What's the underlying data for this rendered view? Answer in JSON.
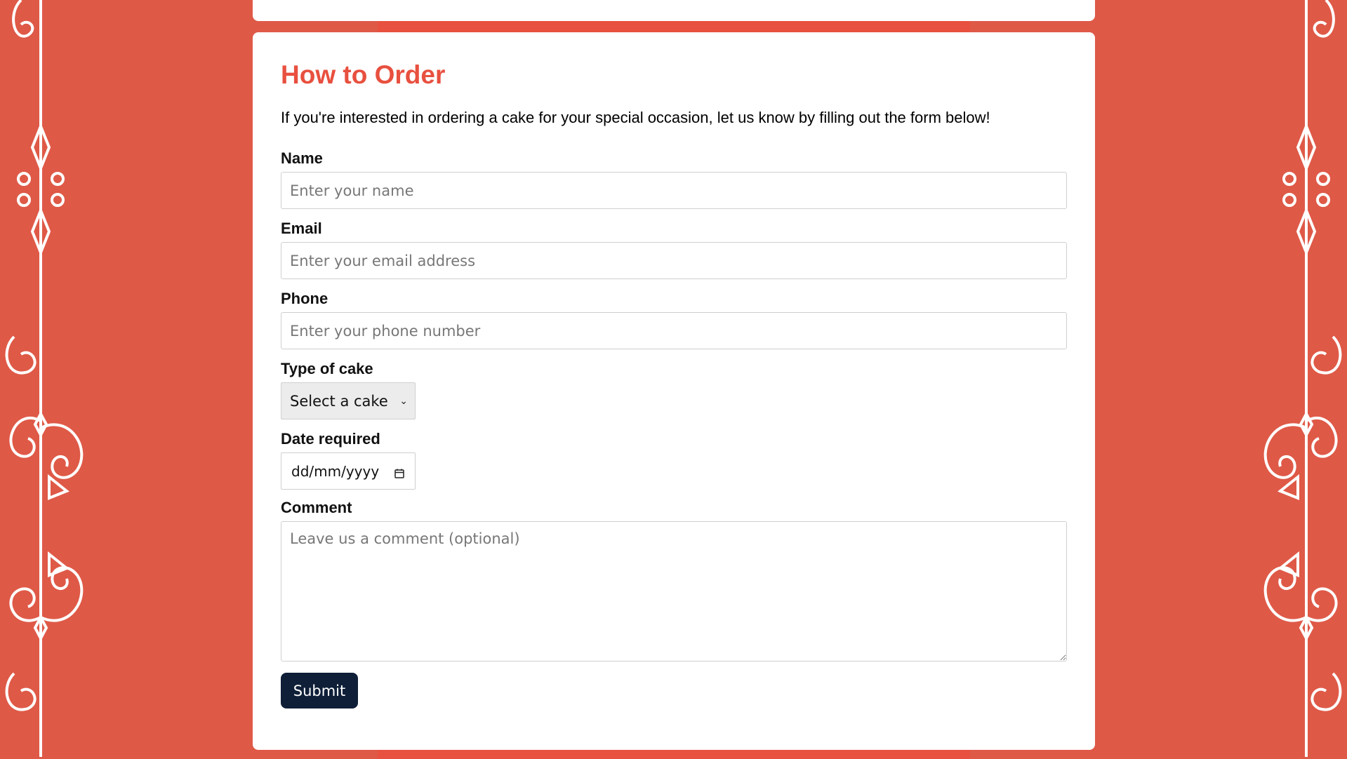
{
  "section": {
    "title": "How to Order",
    "intro": "If you're interested in ordering a cake for your special occasion, let us know by filling out the form below!"
  },
  "form": {
    "name_label": "Name",
    "name_placeholder": "Enter your name",
    "email_label": "Email",
    "email_placeholder": "Enter your email address",
    "phone_label": "Phone",
    "phone_placeholder": "Enter your phone number",
    "cake_label": "Type of cake",
    "cake_selected": "Select a cake",
    "date_label": "Date required",
    "date_placeholder": "dd/mm/yyyy",
    "comment_label": "Comment",
    "comment_placeholder": "Leave us a comment (optional)",
    "submit_label": "Submit"
  },
  "colors": {
    "background": "#df5947",
    "accent": "#e8503f",
    "button": "#0f1f38"
  },
  "icons": {
    "select": "chevron-down-icon",
    "date": "calendar-icon",
    "border": "flourish-ornament"
  }
}
